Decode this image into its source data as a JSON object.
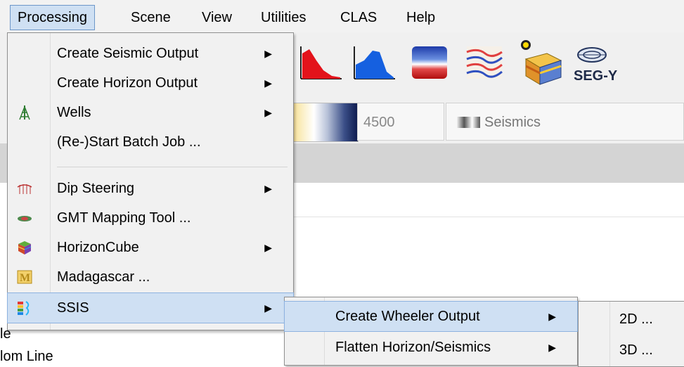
{
  "menubar": {
    "items": [
      "Processing",
      "Scene",
      "View",
      "Utilities",
      "CLAS",
      "Help"
    ]
  },
  "background": {
    "colorbar_value": "4500",
    "seismics_label": "Seismics",
    "tree_items": [
      "le",
      "lom Line"
    ]
  },
  "processing_menu": {
    "items": [
      {
        "label": "Create Seismic Output",
        "icon": "none",
        "submenu": true
      },
      {
        "label": "Create Horizon Output",
        "icon": "none",
        "submenu": true
      },
      {
        "label": "Wells",
        "icon": "well-icon",
        "submenu": true
      },
      {
        "label": "(Re-)Start Batch Job ...",
        "icon": "none",
        "submenu": false
      },
      {
        "label": "Dip Steering",
        "icon": "dip-steering-icon",
        "submenu": true
      },
      {
        "label": "GMT Mapping Tool ...",
        "icon": "gmt-icon",
        "submenu": false
      },
      {
        "label": "HorizonCube",
        "icon": "horizoncube-icon",
        "submenu": true
      },
      {
        "label": "Madagascar ...",
        "icon": "madagascar-icon",
        "submenu": false
      },
      {
        "label": "SSIS",
        "icon": "ssis-icon",
        "submenu": true,
        "highlighted": true
      }
    ]
  },
  "ssis_menu": {
    "items": [
      {
        "label": "Create Wheeler Output",
        "submenu": true,
        "highlighted": true
      },
      {
        "label": "Flatten Horizon/Seismics",
        "submenu": true
      }
    ]
  },
  "wheeler_menu": {
    "items": [
      "2D ...",
      "3D ..."
    ]
  },
  "toolbar_icons": [
    "red-histogram-icon",
    "blue-histogram-icon",
    "colortable-icon",
    "seismic-section-icon",
    "volume-light-icon",
    "segy-icon"
  ],
  "segy_label": "SEG-Y"
}
